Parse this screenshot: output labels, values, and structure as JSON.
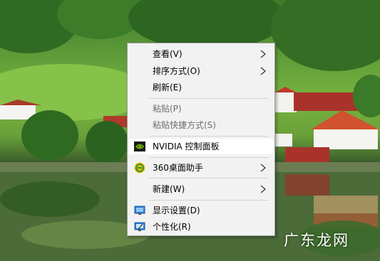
{
  "menu": {
    "items": [
      {
        "label": "查看(V)",
        "submenu": true,
        "disabled": false
      },
      {
        "label": "排序方式(O)",
        "submenu": true,
        "disabled": false
      },
      {
        "label": "刷新(E)",
        "submenu": false,
        "disabled": false
      },
      {
        "label": "粘贴(P)",
        "submenu": false,
        "disabled": true
      },
      {
        "label": "粘贴快捷方式(S)",
        "submenu": false,
        "disabled": true
      },
      {
        "label": "NVIDIA 控制面板",
        "submenu": false,
        "disabled": false,
        "icon": "nvidia-icon"
      },
      {
        "label": "360桌面助手",
        "submenu": true,
        "disabled": false,
        "icon": "360-icon"
      },
      {
        "label": "新建(W)",
        "submenu": true,
        "disabled": false
      },
      {
        "label": "显示设置(D)",
        "submenu": false,
        "disabled": false,
        "icon": "display-icon"
      },
      {
        "label": "个性化(R)",
        "submenu": false,
        "disabled": false,
        "icon": "personalize-icon"
      }
    ]
  },
  "watermark": "广东龙网",
  "colors": {
    "menu_bg": "#f2f2f2",
    "disabled_text": "#6d6d6d",
    "nvidia_green": "#76b900",
    "icon_360_yellow": "#f4c20d"
  }
}
